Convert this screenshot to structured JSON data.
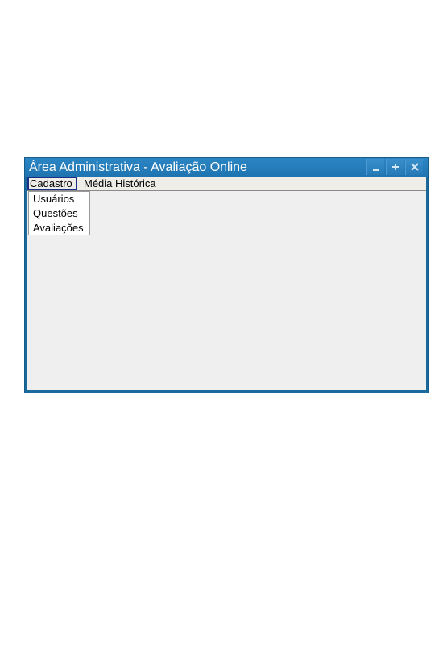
{
  "window": {
    "title": "Área Administrativa - Avaliação Online",
    "controls": {
      "minimize": "minimize-icon",
      "maximize": "plus-icon",
      "close": "close-icon"
    }
  },
  "menubar": {
    "items": [
      {
        "label": "Cadastro",
        "open": true
      },
      {
        "label": "Média Histórica",
        "open": false
      }
    ]
  },
  "dropdown": {
    "items": [
      {
        "label": "Usuários"
      },
      {
        "label": "Questões"
      },
      {
        "label": "Avaliações"
      }
    ]
  },
  "colors": {
    "titlebar": "#1f74b0",
    "frame": "#1a6a9e",
    "client": "#efefef",
    "focus_border": "#1b2f86"
  }
}
